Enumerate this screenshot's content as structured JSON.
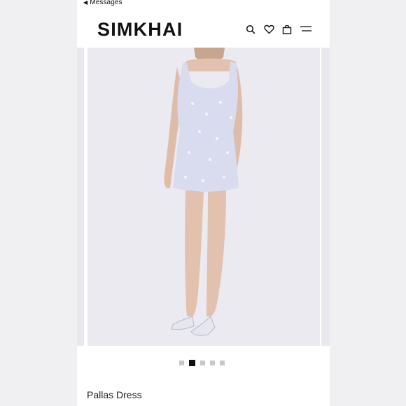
{
  "header": {
    "back_label": "Messages",
    "brand": "SIMKHAI",
    "icons": [
      "search-icon",
      "heart-icon",
      "bag-icon",
      "menu-icon"
    ]
  },
  "gallery": {
    "image_count": 5,
    "active_index": 1,
    "image_description": "model wearing light blue sequin mini dress"
  },
  "product": {
    "name": "Pallas Dress"
  },
  "colors": {
    "brand_text": "#111111",
    "dress": "#d9dcee",
    "background": "#ebeaf0"
  }
}
